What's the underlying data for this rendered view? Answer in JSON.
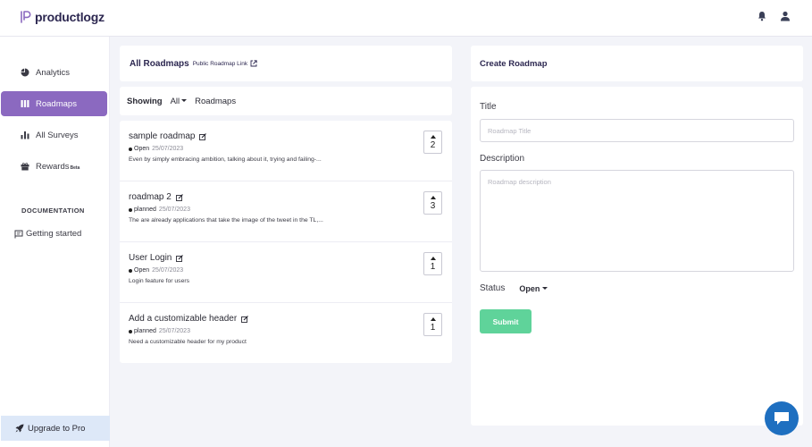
{
  "app": {
    "brand": "productlogz",
    "brand_color": "#8b69c0"
  },
  "topbar": {
    "icons": [
      "bell-icon",
      "user-icon"
    ]
  },
  "sidebar": {
    "items": [
      {
        "label": "Analytics",
        "icon": "pie-chart-icon"
      },
      {
        "label": "Roadmaps",
        "icon": "columns-icon",
        "active": true
      },
      {
        "label": "All Surveys",
        "icon": "bar-chart-icon"
      },
      {
        "label": "Rewards",
        "badge": "Beta",
        "icon": "gift-icon"
      }
    ],
    "documentation_heading": "DOCUMENTATION",
    "getting_started": "Getting started",
    "upgrade": "Upgrade to Pro"
  },
  "roadmaps": {
    "title": "All Roadmaps",
    "public_link": "Public Roadmap Link",
    "showing_label": "Showing",
    "filter_value": "All",
    "showing_suffix": "Roadmaps",
    "items": [
      {
        "title": "sample roadmap",
        "status": "Open",
        "date": "25/07/2023",
        "description": "Even by simply embracing ambition, talking about it, trying and failing-...",
        "votes": "2"
      },
      {
        "title": "roadmap 2",
        "status": "planned",
        "date": "25/07/2023",
        "description": "The are already applications that take the image of the tweet in the TL,...",
        "votes": "3"
      },
      {
        "title": "User Login",
        "status": "Open",
        "date": "25/07/2023",
        "description": "Login feature for users",
        "votes": "1"
      },
      {
        "title": "Add a customizable header",
        "status": "planned",
        "date": "25/07/2023",
        "description": "Need a customizable header for my product",
        "votes": "1"
      }
    ]
  },
  "create": {
    "heading": "Create Roadmap",
    "title_label": "Title",
    "title_placeholder": "Roadmap Title",
    "title_value": "",
    "description_label": "Description",
    "description_placeholder": "Roadmap description",
    "description_value": "",
    "status_label": "Status",
    "status_value": "Open",
    "submit_label": "Submit",
    "submit_color": "#5fd39a"
  },
  "chat": {
    "icon": "chat-bubble-icon",
    "color": "#1e6fc0"
  }
}
